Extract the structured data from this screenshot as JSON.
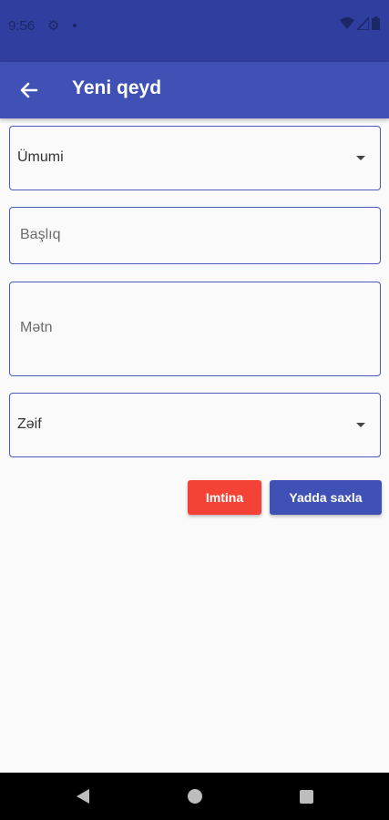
{
  "status_bar": {
    "time": "9:56"
  },
  "app_bar": {
    "title": "Yeni qeyd"
  },
  "form": {
    "category_value": "Ümumi",
    "title_placeholder": "Başlıq",
    "text_placeholder": "Mətn",
    "priority_value": "Zəif"
  },
  "actions": {
    "cancel_label": "Imtina",
    "save_label": "Yadda saxla"
  },
  "colors": {
    "primary": "#3f51b5",
    "primary_dark": "#303f9f",
    "cancel": "#f44336"
  }
}
